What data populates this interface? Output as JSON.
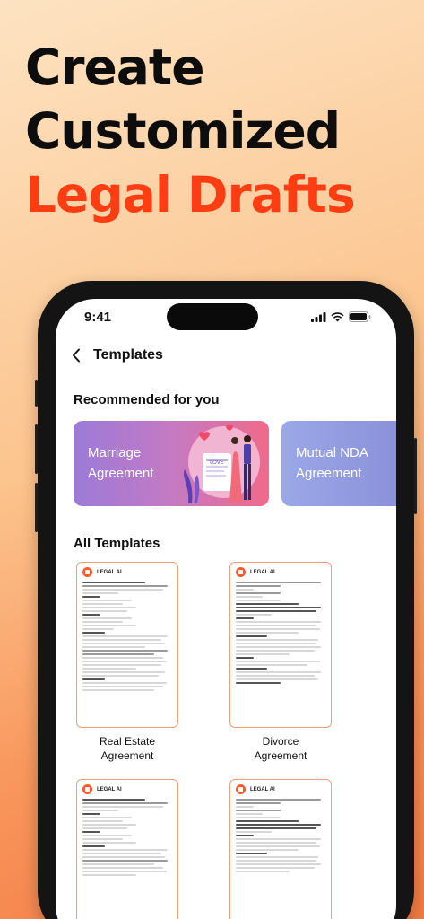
{
  "headline": {
    "line1": "Create",
    "line2": "Customized",
    "line3": "Legal Drafts"
  },
  "status_bar": {
    "time": "9:41",
    "icons": [
      "signal-icon",
      "wifi-icon",
      "battery-icon"
    ]
  },
  "nav": {
    "back_icon": "back-chevron-icon",
    "title": "Templates"
  },
  "recommended": {
    "title": "Recommended for you",
    "cards": [
      {
        "line1": "Marriage",
        "line2": "Agreement",
        "gradient_start": "#9b7bd8",
        "gradient_end": "#f06a8a"
      },
      {
        "line1": "Mutual NDA",
        "line2": "Agreement",
        "gradient_start": "#9aa8e8",
        "gradient_end": "#8b8fd8"
      }
    ]
  },
  "all_templates": {
    "title": "All Templates",
    "items": [
      {
        "brand": "LEGAL AI",
        "name1": "Real Estate",
        "name2": "Agreement"
      },
      {
        "brand": "LEGAL AI",
        "name1": "Divorce",
        "name2": "Agreement"
      },
      {
        "brand": "LEGAL AI",
        "name1": "",
        "name2": ""
      },
      {
        "brand": "LEGAL AI",
        "name1": "",
        "name2": ""
      }
    ]
  },
  "colors": {
    "accent": "#ff3d12",
    "card_border": "#f0a07a"
  }
}
